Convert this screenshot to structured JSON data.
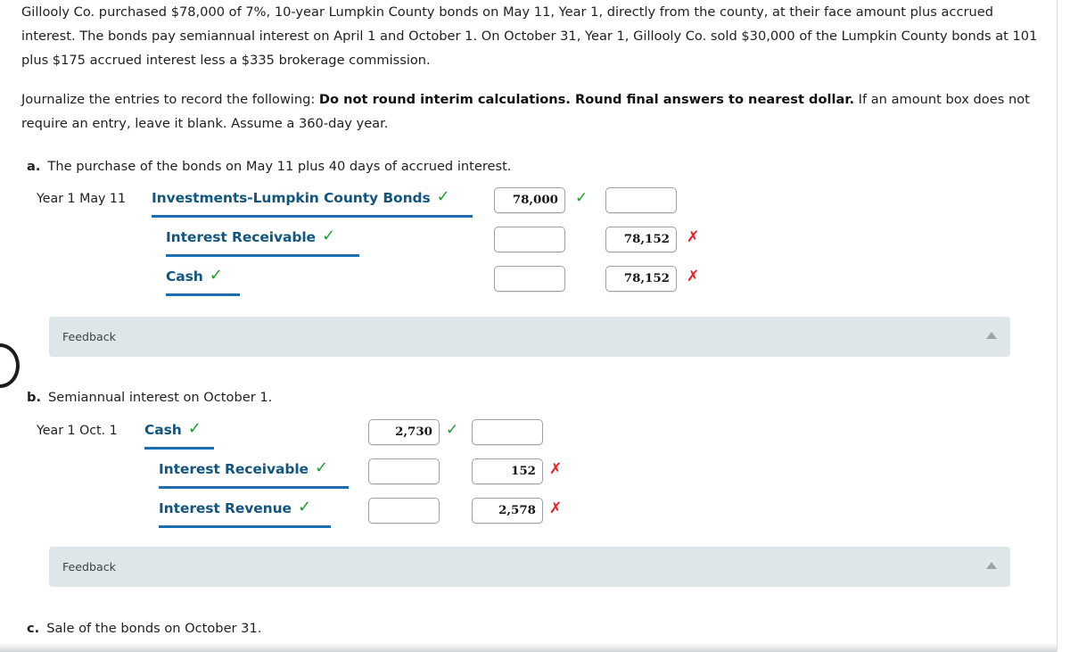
{
  "problem": {
    "intro_prefix": "Gillooly Co. purchased $78,000 of 7%, 10-year Lumpkin County bonds on May 11, Year 1, directly from the county, at their face amount plus accrued interest. The bonds pay semiannual interest on April 1 and October 1. On October 31, Year 1, Gillooly Co. sold $30,000 of the Lumpkin County bonds at 101 plus $175 accrued interest less a $335 brokerage commission.",
    "instructions_prefix": "Journalize the entries to record the following: ",
    "instructions_bold": "Do not round interim calculations. Round final answers to nearest dollar.",
    "instructions_suffix": " If an amount box does not require an entry, leave it blank. Assume a 360-day year."
  },
  "requirements": [
    {
      "letter": "a.",
      "text": "The purchase of the bonds on May 11 plus 40 days of accrued interest."
    },
    {
      "letter": "b.",
      "text": "Semiannual interest on October 1."
    },
    {
      "letter": "c.",
      "text": "Sale of the bonds on October 31."
    }
  ],
  "journal_a": {
    "rows": [
      {
        "date": "Year 1 May 11",
        "account": "Investments-Lumpkin County Bonds",
        "account_mark": "✓",
        "debit": "78,000",
        "debit_mark": "✓",
        "credit": "",
        "credit_mark": ""
      },
      {
        "date": "",
        "account": "Interest Receivable",
        "account_mark": "✓",
        "debit": "",
        "debit_mark": "",
        "credit": "78,152",
        "credit_mark": "✗"
      },
      {
        "date": "",
        "account": "Cash",
        "account_mark": "✓",
        "debit": "",
        "debit_mark": "",
        "credit": "78,152",
        "credit_mark": "✗"
      }
    ]
  },
  "journal_b": {
    "rows": [
      {
        "date": "Year 1 Oct. 1",
        "account": "Cash",
        "account_mark": "✓",
        "debit": "2,730",
        "debit_mark": "✓",
        "credit": "",
        "credit_mark": ""
      },
      {
        "date": "",
        "account": "Interest Receivable",
        "account_mark": "✓",
        "debit": "",
        "debit_mark": "",
        "credit": "152",
        "credit_mark": "✗"
      },
      {
        "date": "",
        "account": "Interest Revenue",
        "account_mark": "✓",
        "debit": "",
        "debit_mark": "",
        "credit": "2,578",
        "credit_mark": "✗"
      }
    ]
  },
  "feedback": {
    "label_a": "Feedback",
    "label_b": "Feedback",
    "toggle_icon": "triangle-up-icon"
  },
  "colors": {
    "account_link": "#12567f",
    "account_underline": "#1b6cb0",
    "correct": "#1f9d2f",
    "incorrect": "#ee1c25",
    "feedback_bg": "#dfe6e9"
  }
}
